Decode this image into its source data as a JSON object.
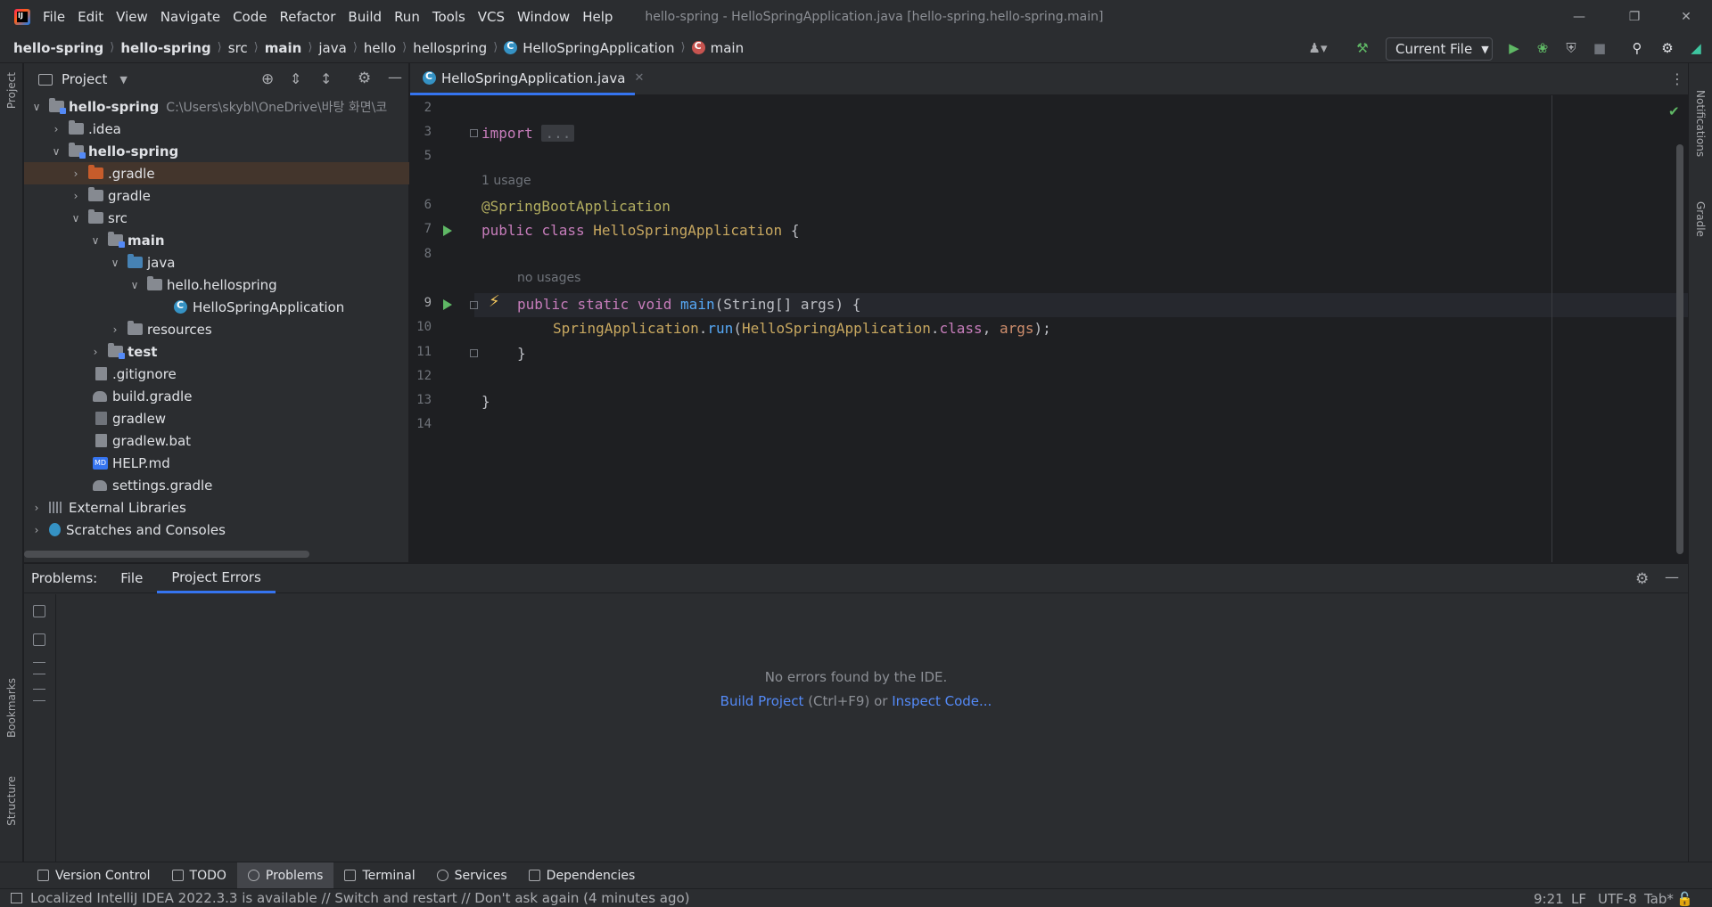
{
  "titlebar": {
    "menus": [
      "File",
      "Edit",
      "View",
      "Navigate",
      "Code",
      "Refactor",
      "Build",
      "Run",
      "Tools",
      "VCS",
      "Window",
      "Help"
    ],
    "window_title": "hello-spring - HelloSpringApplication.java [hello-spring.hello-spring.main]"
  },
  "navbar": {
    "crumbs": [
      "hello-spring",
      "hello-spring",
      "src",
      "main",
      "java",
      "hello",
      "hellospring",
      "HelloSpringApplication",
      "main"
    ],
    "run_config": "Current File"
  },
  "left_stripe": {
    "project": "Project",
    "bookmarks": "Bookmarks",
    "structure": "Structure"
  },
  "right_stripe": {
    "notifications": "Notifications",
    "gradle": "Gradle"
  },
  "project_panel": {
    "title": "Project",
    "tree": [
      {
        "label": "hello-spring",
        "hint": "C:\\Users\\skybl\\OneDrive\\바탕 화면\\코"
      },
      {
        "label": ".idea"
      },
      {
        "label": "hello-spring"
      },
      {
        "label": ".gradle"
      },
      {
        "label": "gradle"
      },
      {
        "label": "src"
      },
      {
        "label": "main"
      },
      {
        "label": "java"
      },
      {
        "label": "hello.hellospring"
      },
      {
        "label": "HelloSpringApplication"
      },
      {
        "label": "resources"
      },
      {
        "label": "test"
      },
      {
        "label": ".gitignore"
      },
      {
        "label": "build.gradle"
      },
      {
        "label": "gradlew"
      },
      {
        "label": "gradlew.bat"
      },
      {
        "label": "HELP.md"
      },
      {
        "label": "settings.gradle"
      },
      {
        "label": "External Libraries"
      },
      {
        "label": "Scratches and Consoles"
      }
    ]
  },
  "editor": {
    "tab": "HelloSpringApplication.java",
    "line_numbers": [
      "2",
      "3",
      "5",
      "6",
      "7",
      "8",
      "9",
      "10",
      "11",
      "12",
      "13",
      "14"
    ],
    "hint_1_usage": "1 usage",
    "hint_no_usages": "no usages",
    "code": {
      "import_kw": "import",
      "import_fold": "...",
      "annotation": "@SpringBootApplication",
      "class_public": "public",
      "class_kw": "class",
      "class_name": "HelloSpringApplication",
      "brace_open": "{",
      "main_public": "public",
      "main_static": "static",
      "main_void": "void",
      "main_name": "main",
      "main_params": "(String[] args) {",
      "run_class": "SpringApplication",
      "run_dot": ".",
      "run_method": "run",
      "run_open": "(",
      "run_arg_class": "HelloSpringApplication",
      "run_dot2": ".",
      "run_class_kw": "class",
      "run_comma": ", ",
      "run_args": "args",
      "run_close": ");",
      "inner_close": "}",
      "outer_close": "}"
    }
  },
  "problems": {
    "label": "Problems:",
    "tabs": [
      "File",
      "Project Errors"
    ],
    "no_errors": "No errors found by the IDE.",
    "build_project": "Build Project",
    "build_shortcut": " (Ctrl+F9) or ",
    "inspect_code": "Inspect Code..."
  },
  "toolwindows": [
    "Version Control",
    "TODO",
    "Problems",
    "Terminal",
    "Services",
    "Dependencies"
  ],
  "status": {
    "message": "Localized IntelliJ IDEA 2022.3.3 is available // Switch and restart // Don't ask again (4 minutes ago)",
    "position": "9:21",
    "line_sep": "LF",
    "encoding": "UTF-8",
    "indent": "Tab*"
  }
}
